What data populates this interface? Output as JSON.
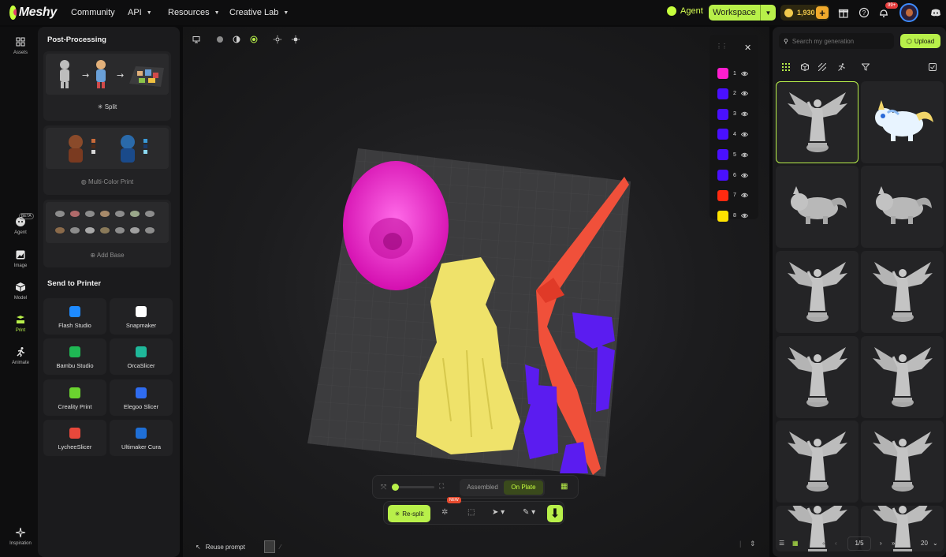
{
  "header": {
    "brand": "Meshy",
    "nav": [
      "Community",
      "API",
      "Resources",
      "Creative Lab"
    ],
    "agent_label": "Agent",
    "workspace_label": "Workspace",
    "credits": "1,930",
    "notifications_badge": "99+"
  },
  "rail": {
    "items": [
      {
        "label": "Assets",
        "icon": "grid-icon"
      },
      {
        "label": "Agent",
        "icon": "agent-icon",
        "badge": "BETA"
      },
      {
        "label": "Image",
        "icon": "image-plus-icon"
      },
      {
        "label": "Model",
        "icon": "cube-icon"
      },
      {
        "label": "Print",
        "icon": "print-icon",
        "active": true
      },
      {
        "label": "Animate",
        "icon": "running-figure-icon"
      },
      {
        "label": "Inspiration",
        "icon": "sparkle-icon"
      }
    ]
  },
  "postprocessing": {
    "title": "Post-Processing",
    "cards": [
      {
        "label": "Split"
      },
      {
        "label": "Multi-Color Print"
      },
      {
        "label": "Add Base"
      }
    ]
  },
  "printers": {
    "title": "Send to Printer",
    "items": [
      {
        "label": "Flash Studio",
        "color": "#1e8bff"
      },
      {
        "label": "Snapmaker",
        "color": "#ffffff"
      },
      {
        "label": "Bambu Studio",
        "color": "#1fb854"
      },
      {
        "label": "OrcaSlicer",
        "color": "#1fb89a"
      },
      {
        "label": "Creality Print",
        "color": "#6bd42f"
      },
      {
        "label": "Elegoo Slicer",
        "color": "#2f6cf0"
      },
      {
        "label": "LycheeSlicer",
        "color": "#e8483b"
      },
      {
        "label": "Ultimaker Cura",
        "color": "#1f6fd6"
      }
    ]
  },
  "layers": [
    {
      "label": "1",
      "color": "#ff1ecf"
    },
    {
      "label": "2",
      "color": "#4a10ff"
    },
    {
      "label": "3",
      "color": "#4a10ff"
    },
    {
      "label": "4",
      "color": "#4a10ff"
    },
    {
      "label": "5",
      "color": "#4a10ff"
    },
    {
      "label": "6",
      "color": "#4a10ff"
    },
    {
      "label": "7",
      "color": "#ff2a10"
    },
    {
      "label": "8",
      "color": "#ffe300"
    }
  ],
  "viewport": {
    "view_modes": [
      "Assembled",
      "On Plate"
    ],
    "active_view": "On Plate",
    "resplit_label": "Re-split",
    "new_badge": "NEW",
    "reuse_prompt": "Reuse prompt"
  },
  "gallery": {
    "search_placeholder": "Search my generation",
    "upload_label": "Upload",
    "page_current": "1/5",
    "page_size": "20"
  },
  "colors": {
    "accent": "#b8f04a",
    "panel": "#1b1b1d",
    "background": "#0b0b0c"
  }
}
